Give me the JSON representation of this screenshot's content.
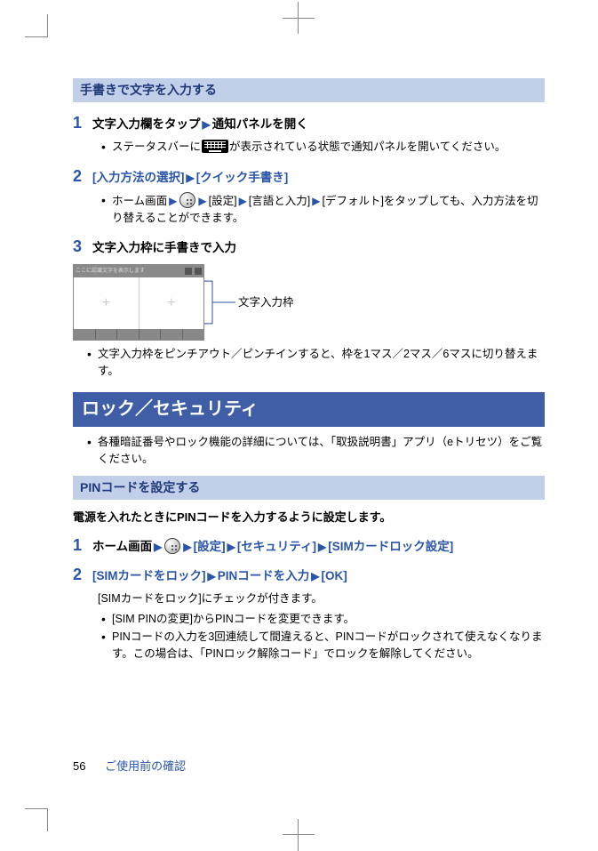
{
  "sections": {
    "handwrite_title": "手書きで文字を入力する",
    "step1": {
      "title_a": "文字入力欄をタップ",
      "title_b": "通知パネルを開く",
      "bullet_a": "ステータスバーに",
      "bullet_b": "が表示されている状態で通知パネルを開いてください。"
    },
    "step2": {
      "title_a": "[入力方法の選択]",
      "title_b": "[クイック手書き]",
      "bullet_a": "ホーム画面",
      "bullet_parts": [
        "[設定]",
        "[言語と入力]",
        "[デフォルト]をタップしても、入力方法を切り替えることができます。"
      ]
    },
    "step3": {
      "title": "文字入力枠に手書きで入力",
      "hw_placeholder": "ここに認識文字を表示します",
      "callout": "文字入力枠",
      "bullet": "文字入力枠をピンチアウト／ピンチインすると、枠を1マス／2マス／6マスに切り替えます。"
    }
  },
  "lock_section": {
    "title": "ロック／セキュリティ",
    "bullet": "各種暗証番号やロック機能の詳細については、「取扱説明書」アプリ（eトリセツ）をご覧ください。",
    "pin_sub": "PINコードを設定する",
    "lead": "電源を入れたときにPINコードを入力するように設定します。",
    "pin_step1": {
      "a": "ホーム画面",
      "parts": [
        "[設定]",
        "[セキュリティ]",
        "[SIMカードロック設定]"
      ]
    },
    "pin_step2": {
      "parts": [
        "[SIMカードをロック]",
        "PINコードを入力",
        "[OK]"
      ],
      "after": "[SIMカードをロック]にチェックが付きます。",
      "bullets": [
        "[SIM PINの変更]からPINコードを変更できます。",
        "PINコードの入力を3回連続して間違えると、PINコードがロックされて使えなくなります。この場合は、「PINロック解除コード」でロックを解除してください。"
      ]
    }
  },
  "footer": {
    "page": "56",
    "text": "ご使用前の確認"
  }
}
